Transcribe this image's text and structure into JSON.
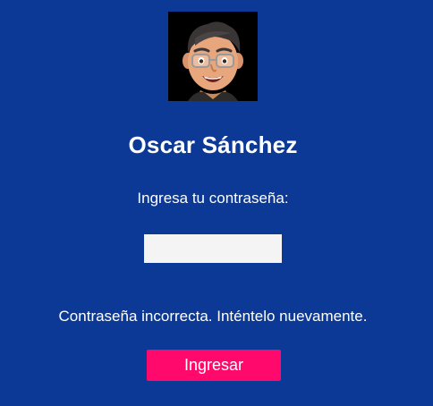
{
  "login": {
    "user_name": "Oscar Sánchez",
    "prompt": "Ingresa tu contraseña:",
    "password_value": "",
    "error_message": "Contraseña incorrecta. Inténtelo nuevamente.",
    "submit_label": "Ingresar"
  },
  "avatar": {
    "icon": "memoji-avatar-icon"
  },
  "colors": {
    "background": "#0b3995",
    "button": "#ff0a6c",
    "input_background": "#f4f4f4",
    "text": "#ffffff"
  }
}
